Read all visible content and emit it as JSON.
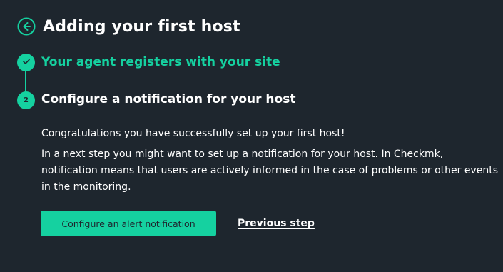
{
  "header": {
    "back_icon": "arrow-left-circle-icon",
    "title": "Adding your first host"
  },
  "steps": [
    {
      "marker": "",
      "marker_icon": "checkmark-icon",
      "title": "Your agent registers with your site",
      "state": "completed"
    },
    {
      "marker": "2",
      "title": "Configure a notification for your host",
      "state": "active",
      "paragraphs": [
        "Congratulations you have successfully set up your first host!",
        "In a next step you might want to set up a notification for your host. In Checkmk, notification means that users are actively informed in the case of problems or other events in the monitoring."
      ],
      "primary_button": "Configure an alert notification",
      "secondary_link": "Previous step"
    }
  ],
  "colors": {
    "background": "#1e262e",
    "accent": "#15d1a0",
    "text": "#ffffff"
  }
}
